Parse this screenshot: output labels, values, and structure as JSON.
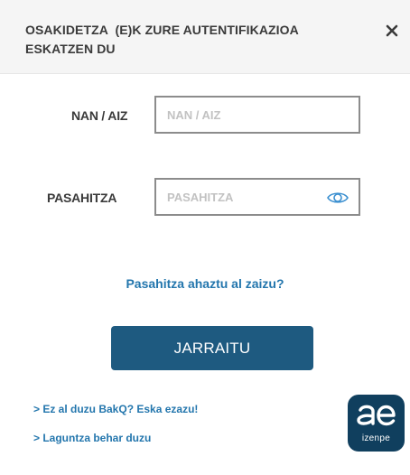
{
  "dialog": {
    "title": "OSAKIDETZA  (E)K ZURE AUTENTIFIKAZIOA ESKATZEN DU",
    "close_icon": "close-icon"
  },
  "form": {
    "id_label": "NAN / AIZ",
    "id_placeholder": "NAN / AIZ",
    "id_value": "",
    "password_label": "PASAHITZA",
    "password_placeholder": "PASAHITZA",
    "password_value": "",
    "password_toggle_icon": "eye-icon"
  },
  "links": {
    "forgot_password": "Pasahitza ahaztu al zaizu?",
    "no_bakq": "> Ez al duzu BakQ? Eska ezazu!",
    "need_help": "> Laguntza behar duzu"
  },
  "actions": {
    "submit_label": "JARRAITU"
  },
  "logo": {
    "mark": "ae",
    "text": "izenpe"
  },
  "colors": {
    "header_bg": "#f5f5f5",
    "primary_button": "#1e5a80",
    "link": "#2376ad",
    "logo_bg": "#103f5e",
    "eye_icon": "#3a8fd0"
  }
}
